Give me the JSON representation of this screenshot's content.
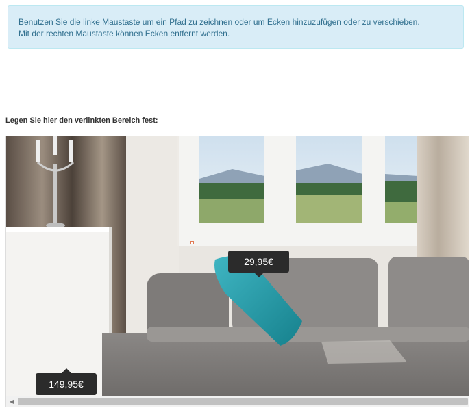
{
  "info": {
    "line1": "Benutzen Sie die linke Maustaste um ein Pfad zu zeichnen oder um Ecken hinzuzufügen oder zu verschieben.",
    "line2": "Mit der rechten Maustaste können Ecken entfernt werden."
  },
  "section_label": "Legen Sie hier den verlinkten Bereich fest:",
  "hotspots": [
    {
      "price": "29,95€"
    },
    {
      "price": "149,95€"
    }
  ],
  "colors": {
    "info_bg": "#d9edf7",
    "info_text": "#31708f",
    "tag_bg": "#2b2b2b",
    "marker": "#e07a55"
  }
}
